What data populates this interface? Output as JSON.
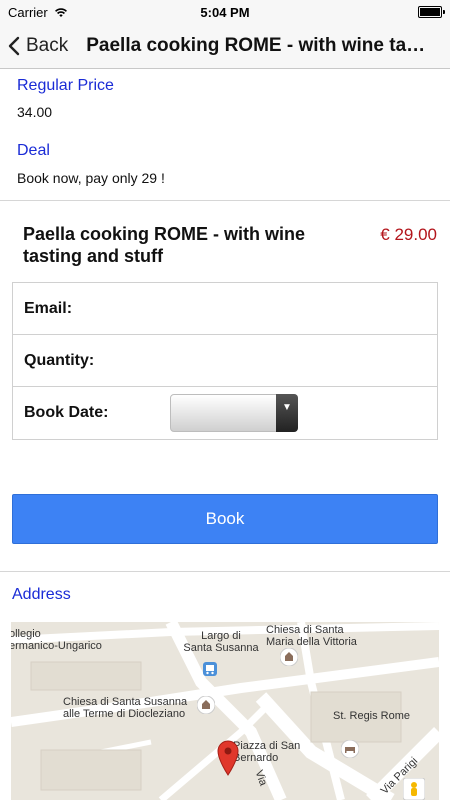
{
  "status_bar": {
    "carrier": "Carrier",
    "time": "5:04 PM"
  },
  "nav": {
    "back_label": "Back",
    "title": "Paella cooking ROME - with wine tasting and stuff"
  },
  "details": {
    "regular_price_label": "Regular Price",
    "regular_price_value": "34.00",
    "deal_label": "Deal",
    "deal_value": "Book now, pay only 29 !"
  },
  "booking": {
    "title": "Paella cooking ROME - with wine tasting and stuff",
    "price": "€ 29.00",
    "email_label": "Email:",
    "quantity_label": "Quantity:",
    "book_date_label": "Book Date:",
    "book_date_value": "",
    "book_button": "Book"
  },
  "address": {
    "label": "Address"
  },
  "map": {
    "labels": {
      "collegio": "ollegio\nermanico-Ungarico",
      "largo": "Largo di\nSanta Susanna",
      "chiesa_maria": "Chiesa di Santa\nMaria della Vittoria",
      "chiesa_susanna": "Chiesa di Santa Susanna\nalle Terme di Diocleziano",
      "st_regis": "St. Regis Rome",
      "piazza": "Piazza di San\nBernardo",
      "via_parigi": "Via Parigi",
      "via": "Via"
    },
    "colors": {
      "marker": "#e0372b",
      "road": "#ffffff",
      "block": "#e9e5dc"
    }
  },
  "colors": {
    "link_blue": "#1a2bd6",
    "price_red": "#b3141b",
    "button_blue": "#3d82f4"
  }
}
